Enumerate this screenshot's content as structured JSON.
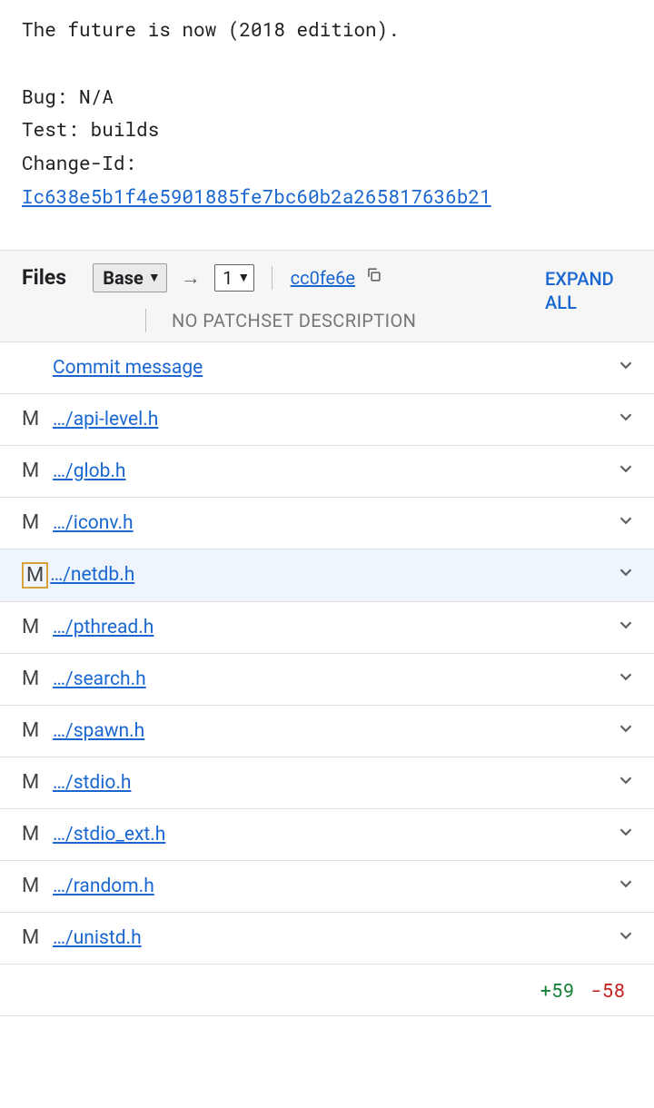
{
  "commit": {
    "subject": "The future is now (2018 edition).",
    "bug_label": "Bug:",
    "bug_value": "N/A",
    "test_label": "Test:",
    "test_value": "builds",
    "change_id_label": "Change-Id:",
    "change_id": "Ic638e5b1f4e5901885fe7bc60b2a265817636b21"
  },
  "header": {
    "files_label": "Files",
    "base_label": "Base",
    "arrow": "→",
    "patchset_number": "1",
    "hash": "cc0fe6e",
    "expand_all": "EXPAND ALL",
    "no_patchset_desc": "NO PATCHSET DESCRIPTION"
  },
  "files": [
    {
      "status": "",
      "name": "Commit message",
      "highlight": false,
      "boxed": false
    },
    {
      "status": "M",
      "name": "…/api-level.h",
      "highlight": false,
      "boxed": false
    },
    {
      "status": "M",
      "name": "…/glob.h",
      "highlight": false,
      "boxed": false
    },
    {
      "status": "M",
      "name": "…/iconv.h",
      "highlight": false,
      "boxed": false
    },
    {
      "status": "M",
      "name": "…/netdb.h",
      "highlight": true,
      "boxed": true
    },
    {
      "status": "M",
      "name": "…/pthread.h",
      "highlight": false,
      "boxed": false
    },
    {
      "status": "M",
      "name": "…/search.h",
      "highlight": false,
      "boxed": false
    },
    {
      "status": "M",
      "name": "…/spawn.h",
      "highlight": false,
      "boxed": false
    },
    {
      "status": "M",
      "name": "…/stdio.h",
      "highlight": false,
      "boxed": false
    },
    {
      "status": "M",
      "name": "…/stdio_ext.h",
      "highlight": false,
      "boxed": false
    },
    {
      "status": "M",
      "name": "…/random.h",
      "highlight": false,
      "boxed": false
    },
    {
      "status": "M",
      "name": "…/unistd.h",
      "highlight": false,
      "boxed": false
    }
  ],
  "totals": {
    "adds": "+59",
    "dels": "-58"
  }
}
